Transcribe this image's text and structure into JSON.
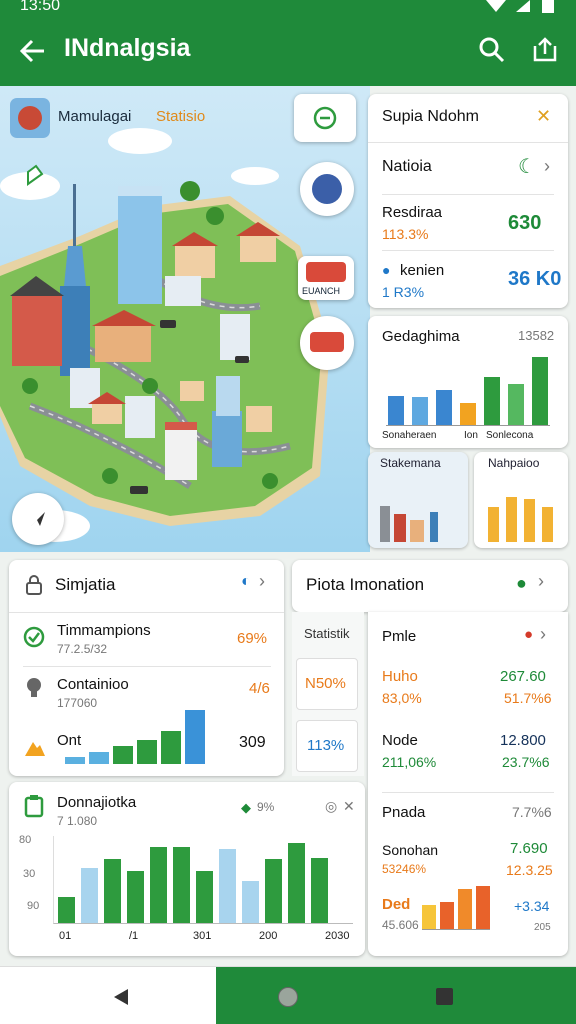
{
  "status": {
    "time": "13:50"
  },
  "appbar": {
    "title": "INdnalgsia"
  },
  "map": {
    "badge_title_a": "Mamulagai",
    "badge_title_b": "Statisio",
    "marker_label": "EUANCH"
  },
  "right_panel": {
    "header": "Supia Ndohm",
    "nav_label": "Natioia",
    "stat1": {
      "label": "Resdiraa",
      "sub": "113.3%",
      "value": "630"
    },
    "stat2": {
      "label": "kenien",
      "sub": "1 R3%",
      "value": "36 K0"
    },
    "chart_title": "Gedaghima",
    "chart_value": "13582",
    "chart_labels": [
      "Sonaheraen",
      "Ion",
      "Sonlecona"
    ],
    "chart_values": [
      0.42,
      0.4,
      0.5,
      0.32,
      0.7,
      0.6,
      0.98
    ],
    "mini_left": "Stakemana",
    "mini_right": "Nahpaioo",
    "mini_right_values": [
      0.7,
      0.9,
      0.85,
      0.7
    ]
  },
  "similarity": {
    "title": "Simjatia",
    "rows": [
      {
        "label": "Timmampions",
        "sub": "77.2.5/32",
        "value": "69%"
      },
      {
        "label": "Containioo",
        "sub": "177060",
        "value": "4/6"
      },
      {
        "label": "Ont",
        "sub": "",
        "value": "309"
      }
    ],
    "sparkline_values": [
      0.12,
      0.2,
      0.3,
      0.4,
      0.55,
      0.9
    ]
  },
  "donations": {
    "title": "Donnajiotka",
    "sub": "7 1.080",
    "badge": "9%",
    "y_ticks": [
      "80",
      "30",
      "90"
    ],
    "x_ticks": [
      "01",
      "/1",
      "301",
      "200",
      "2030"
    ],
    "values": [
      0.3,
      0.63,
      0.73,
      0.6,
      0.87,
      0.87,
      0.6,
      0.85,
      0.48,
      0.73,
      0.92,
      0.75
    ],
    "series_colors": [
      "#2e9b3e",
      "#a8d4ee"
    ]
  },
  "photo": {
    "title": "Piota Imonation",
    "stats_label": "Statistik",
    "stat_a": "N50%",
    "stat_b": "113%",
    "rows": [
      {
        "label": "Pmle",
        "sub": "",
        "value": "",
        "sub2": ""
      },
      {
        "label": "Huho",
        "sub": "83,0%",
        "value": "267.60",
        "sub2": "51.7%6"
      },
      {
        "label": "Node",
        "sub": "211,06%",
        "value": "12.800",
        "sub2": "23.7%6"
      },
      {
        "label": "Pnada",
        "sub": "",
        "value": "7.7%6",
        "sub2": ""
      },
      {
        "label": "Sonohan",
        "sub": "53246%",
        "value": "7.690",
        "sub2": "12.3.25"
      },
      {
        "label": "Ded",
        "sub": "45.606",
        "value": "+3.34",
        "sub2": "205"
      }
    ],
    "mini_chart_values": [
      0.4,
      0.45,
      0.65,
      0.7
    ]
  },
  "colors": {
    "brand": "#1f8a3a",
    "accent_blue": "#1f78c8",
    "accent_orange": "#e87a1a"
  }
}
